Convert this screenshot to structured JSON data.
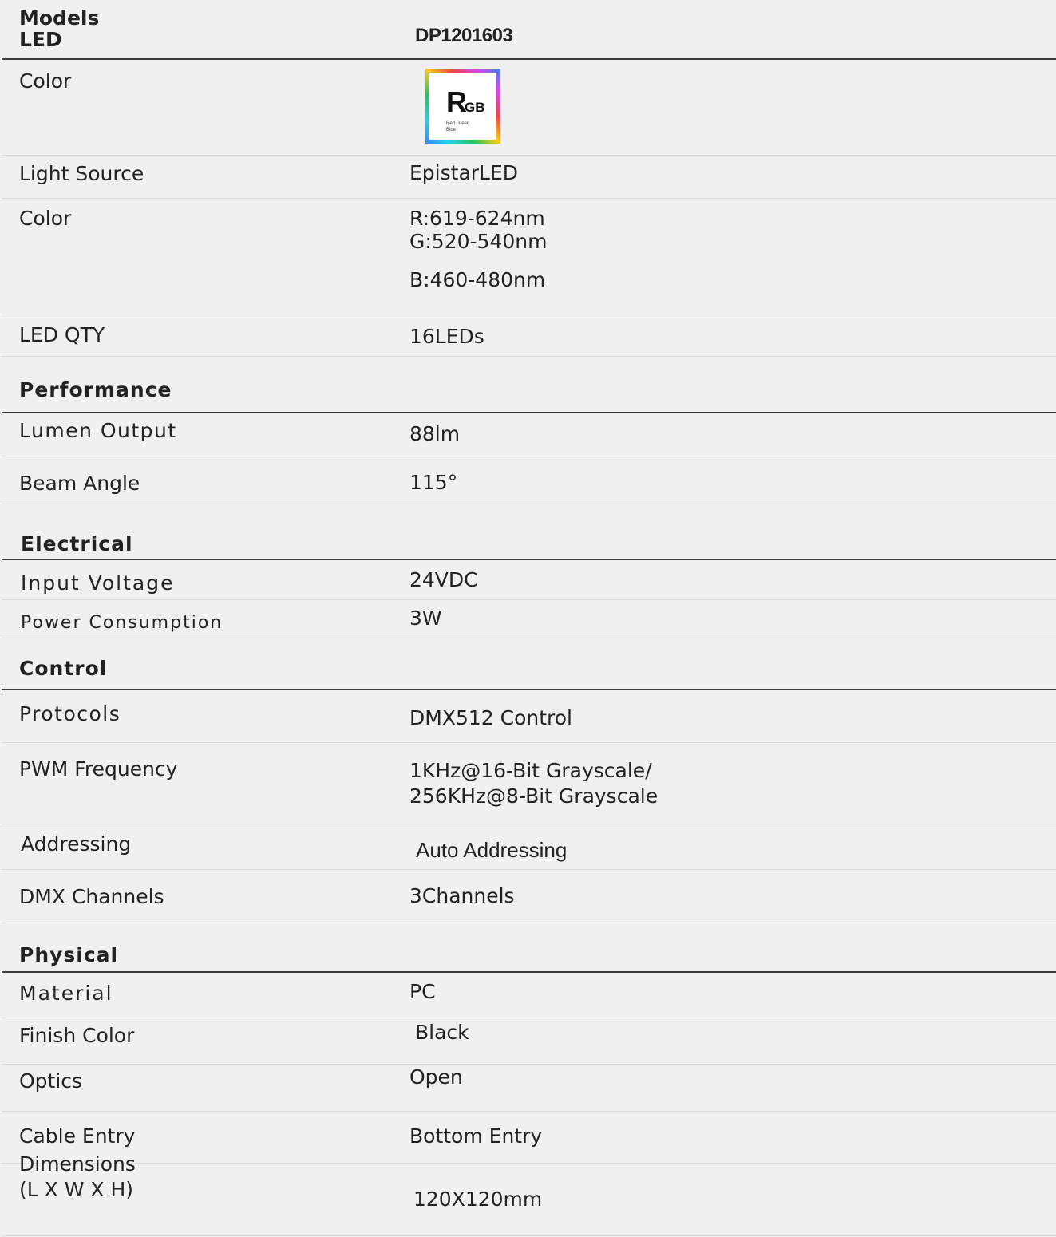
{
  "header": {
    "label_line1": "Models",
    "label_line2": "LED",
    "model": "DP1201603"
  },
  "rgb_logo": {
    "big": "R",
    "small": "GB",
    "subtitle_1": "Red Green",
    "subtitle_2": "Blue"
  },
  "rows": {
    "color1": {
      "label": "Color"
    },
    "light_source": {
      "label": "Light Source",
      "value": "EpistarLED"
    },
    "color2": {
      "label": "Color",
      "value_r": "R:619-624nm",
      "value_g": "G:520-540nm",
      "value_b": "B:460-480nm"
    },
    "led_qty": {
      "label": "LED QTY",
      "value": "16LEDs"
    },
    "lumen": {
      "label": "Lumen Output",
      "value": "88lm"
    },
    "beam": {
      "label": "Beam Angle",
      "value": "115°"
    },
    "input_voltage": {
      "label": "Input Voltage",
      "value": "24VDC"
    },
    "power": {
      "label": "Power Consumption",
      "value": "3W"
    },
    "protocols": {
      "label": "Protocols",
      "value": "DMX512 Control"
    },
    "pwm": {
      "label": "PWM Frequency",
      "value_1": "1KHz@16-Bit Grayscale/",
      "value_2": "256KHz@8-Bit Grayscale"
    },
    "addressing": {
      "label": "Addressing",
      "value": "Auto Addressing"
    },
    "dmx_channels": {
      "label": "DMX Channels",
      "value": "3Channels"
    },
    "material": {
      "label": "Material",
      "value": "PC"
    },
    "finish": {
      "label": "Finish Color",
      "value": "Black"
    },
    "optics": {
      "label": "Optics",
      "value": "Open"
    },
    "cable": {
      "label": "Cable Entry",
      "value": "Bottom Entry"
    },
    "dimensions": {
      "label_1": "Dimensions",
      "label_2": "(L X W X H)",
      "value": "120X120mm"
    }
  },
  "sections": {
    "performance": "Performance",
    "electrical": "Electrical",
    "control": "Control",
    "physical": "Physical"
  }
}
